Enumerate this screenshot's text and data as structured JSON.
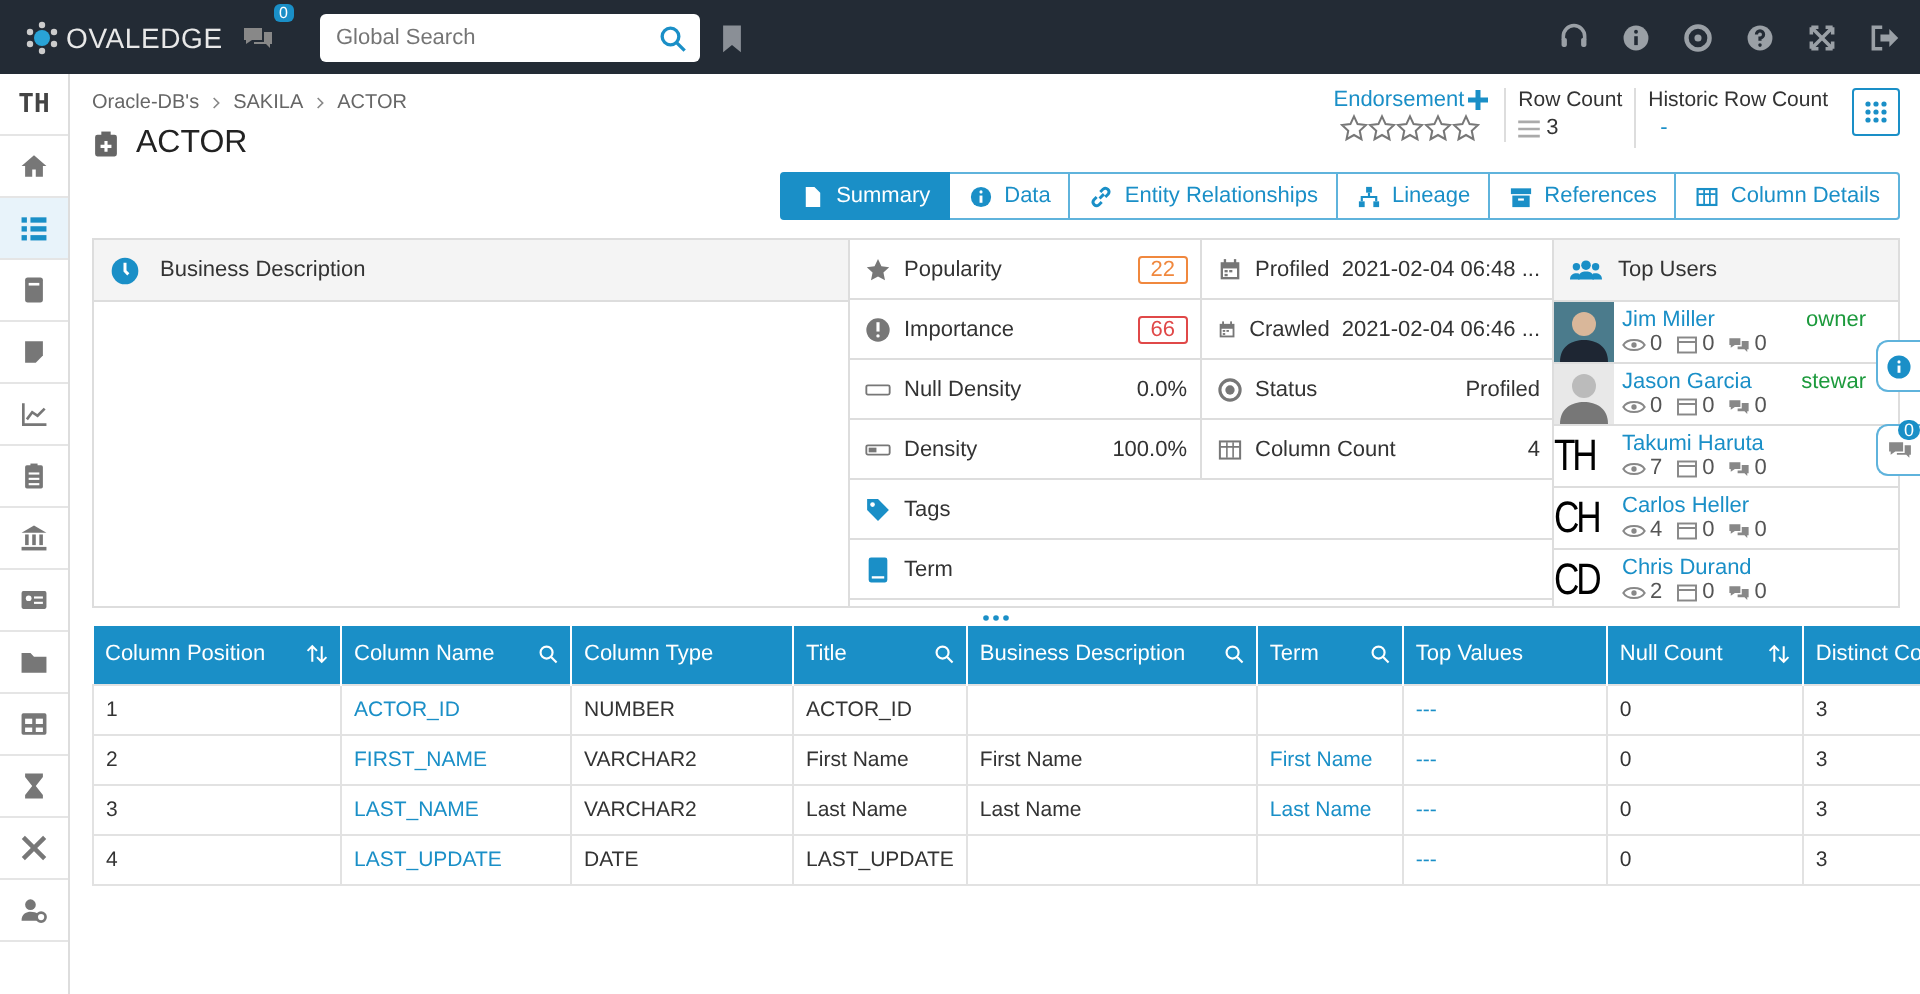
{
  "header": {
    "logo": "OVALEDGE",
    "chat_badge": "0",
    "search": {
      "placeholder": "Global Search"
    }
  },
  "sidebar": {
    "avatar": "TH",
    "items": [
      {
        "selected": false
      },
      {
        "selected": true
      },
      {
        "selected": false
      },
      {
        "selected": false
      },
      {
        "selected": false
      },
      {
        "selected": false
      },
      {
        "selected": false
      },
      {
        "selected": false
      },
      {
        "selected": false
      },
      {
        "selected": false
      },
      {
        "selected": false
      },
      {
        "selected": false
      },
      {
        "selected": false
      }
    ]
  },
  "breadcrumb": [
    "Oracle-DB's",
    "SAKILA",
    "ACTOR"
  ],
  "title": "ACTOR",
  "endorsement": {
    "label": "Endorsement",
    "stars": 0
  },
  "row_count": {
    "label": "Row Count",
    "value": "3"
  },
  "historic_row_count": {
    "label": "Historic Row Count",
    "value": "-"
  },
  "tabs": [
    {
      "label": "Summary",
      "selected": true
    },
    {
      "label": "Data",
      "selected": false
    },
    {
      "label": "Entity Relationships",
      "selected": false
    },
    {
      "label": "Lineage",
      "selected": false
    },
    {
      "label": "References",
      "selected": false
    },
    {
      "label": "Column Details",
      "selected": false
    }
  ],
  "business_description": {
    "label": "Business Description"
  },
  "stats": [
    {
      "label": "Popularity",
      "value": "22",
      "color": "#f0883e",
      "kind": "badge"
    },
    {
      "label": "Importance",
      "value": "66",
      "color": "#e04848",
      "kind": "badge"
    },
    {
      "label": "Null Density",
      "value": "0.0%",
      "kind": "text"
    },
    {
      "label": "Density",
      "value": "100.0%",
      "kind": "text"
    }
  ],
  "tags": {
    "label": "Tags"
  },
  "term": {
    "label": "Term"
  },
  "details": [
    {
      "label": "Profiled",
      "value": "2021-02-04 06:48 ..."
    },
    {
      "label": "Crawled",
      "value": "2021-02-04 06:46 ..."
    },
    {
      "label": "Status",
      "value": "Profiled"
    },
    {
      "label": "Column Count",
      "value": "4"
    }
  ],
  "top_users": {
    "label": "Top Users",
    "users": [
      {
        "name": "Jim Miller",
        "role": "owner",
        "kind": "photo",
        "views": "0",
        "queries": "0",
        "comments": "0"
      },
      {
        "name": "Jason Garcia",
        "role": "stewar",
        "kind": "photo",
        "views": "0",
        "queries": "0",
        "comments": "0"
      },
      {
        "name": "Takumi Haruta",
        "initials": "TH",
        "kind": "initials",
        "views": "7",
        "queries": "0",
        "comments": "0"
      },
      {
        "name": "Carlos Heller",
        "initials": "CH",
        "kind": "initials",
        "views": "4",
        "queries": "0",
        "comments": "0"
      },
      {
        "name": "Chris Durand",
        "initials": "CD",
        "kind": "initials",
        "views": "2",
        "queries": "0",
        "comments": "0"
      }
    ]
  },
  "side_chat_badge": "0",
  "table": {
    "columns": [
      {
        "label": "Column Position",
        "sortable": true,
        "searchable": false,
        "kind": "text"
      },
      {
        "label": "Column Name",
        "sortable": false,
        "searchable": true,
        "kind": "link"
      },
      {
        "label": "Column Type",
        "kind": "text"
      },
      {
        "label": "Title",
        "sortable": false,
        "searchable": true,
        "kind": "text"
      },
      {
        "label": "Business Description",
        "sortable": false,
        "searchable": true,
        "kind": "text"
      },
      {
        "label": "Term",
        "sortable": false,
        "searchable": true,
        "kind": "link"
      },
      {
        "label": "Top Values",
        "kind": "link"
      },
      {
        "label": "Null Count",
        "sortable": true,
        "searchable": false,
        "kind": "text"
      },
      {
        "label": "Distinct Co",
        "kind": "text"
      }
    ],
    "rows": [
      [
        "1",
        "ACTOR_ID",
        "NUMBER",
        "ACTOR_ID",
        "",
        "",
        "---",
        "0",
        "3"
      ],
      [
        "2",
        "FIRST_NAME",
        "VARCHAR2",
        "First Name",
        "First Name",
        "First Name",
        "---",
        "0",
        "3"
      ],
      [
        "3",
        "LAST_NAME",
        "VARCHAR2",
        "Last Name",
        "Last Name",
        "Last Name",
        "---",
        "0",
        "3"
      ],
      [
        "4",
        "LAST_UPDATE",
        "DATE",
        "LAST_UPDATE",
        "",
        "",
        "---",
        "0",
        "3"
      ]
    ]
  }
}
